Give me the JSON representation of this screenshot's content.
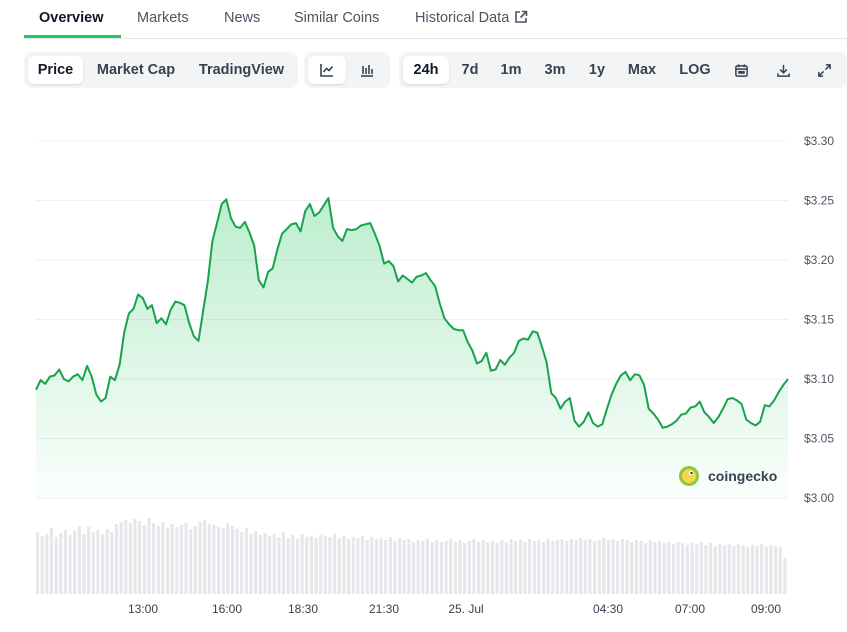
{
  "tabs": [
    {
      "label": "Overview",
      "active": true
    },
    {
      "label": "Markets"
    },
    {
      "label": "News"
    },
    {
      "label": "Similar Coins"
    },
    {
      "label": "Historical Data",
      "external": true
    }
  ],
  "toolbar": {
    "metric_buttons": [
      "Price",
      "Market Cap",
      "TradingView"
    ],
    "active_metric": "Price",
    "chart_type_buttons": [
      "line-chart-icon",
      "candlestick-icon"
    ],
    "active_chart_type": "line-chart-icon",
    "range_buttons": [
      "24h",
      "7d",
      "1m",
      "3m",
      "1y",
      "Max",
      "LOG"
    ],
    "active_range": "24h",
    "action_icons": [
      "calendar-icon",
      "download-icon",
      "expand-icon"
    ]
  },
  "colors": {
    "accent": "#22c55e",
    "line": "#16a34a",
    "volume": "#e5e7eb"
  },
  "watermark": {
    "text": "coingecko"
  },
  "chart_data": {
    "type": "area",
    "xlabel": "",
    "ylabel": "",
    "ylim": [
      3.0,
      3.3
    ],
    "y_ticks": [
      "$3.30",
      "$3.25",
      "$3.20",
      "$3.15",
      "$3.10",
      "$3.05",
      "$3.00"
    ],
    "x_ticks": [
      "13:00",
      "16:00",
      "18:30",
      "21:30",
      "25. Jul",
      "04:30",
      "07:00",
      "09:00"
    ],
    "grid": true,
    "legend": "none",
    "series": [
      {
        "values": [
          3.091,
          3.099,
          3.096,
          3.102,
          3.103,
          3.108,
          3.1,
          3.098,
          3.102,
          3.104,
          3.099,
          3.111,
          3.102,
          3.087,
          3.081,
          3.084,
          3.102,
          3.099,
          3.112,
          3.139,
          3.155,
          3.159,
          3.171,
          3.168,
          3.159,
          3.162,
          3.147,
          3.151,
          3.146,
          3.158,
          3.165,
          3.164,
          3.162,
          3.147,
          3.136,
          3.132,
          3.157,
          3.182,
          3.216,
          3.231,
          3.247,
          3.251,
          3.235,
          3.228,
          3.227,
          3.232,
          3.223,
          3.212,
          3.183,
          3.177,
          3.19,
          3.193,
          3.209,
          3.222,
          3.226,
          3.23,
          3.231,
          3.224,
          3.241,
          3.247,
          3.237,
          3.24,
          3.246,
          3.252,
          3.227,
          3.22,
          3.216,
          3.226,
          3.225,
          3.226,
          3.229,
          3.23,
          3.231,
          3.222,
          3.212,
          3.197,
          3.199,
          3.195,
          3.182,
          3.187,
          3.184,
          3.181,
          3.186,
          3.187,
          3.189,
          3.183,
          3.178,
          3.163,
          3.151,
          3.146,
          3.142,
          3.141,
          3.141,
          3.131,
          3.124,
          3.113,
          3.115,
          3.122,
          3.107,
          3.108,
          3.116,
          3.112,
          3.118,
          3.122,
          3.132,
          3.134,
          3.133,
          3.14,
          3.139,
          3.127,
          3.114,
          3.088,
          3.084,
          3.075,
          3.081,
          3.084,
          3.065,
          3.06,
          3.064,
          3.072,
          3.063,
          3.06,
          3.062,
          3.075,
          3.087,
          3.096,
          3.103,
          3.106,
          3.099,
          3.104,
          3.103,
          3.095,
          3.075,
          3.071,
          3.066,
          3.059,
          3.06,
          3.062,
          3.065,
          3.07,
          3.071,
          3.076,
          3.077,
          3.081,
          3.072,
          3.068,
          3.063,
          3.068,
          3.075,
          3.083,
          3.084,
          3.082,
          3.079,
          3.066,
          3.063,
          3.061,
          3.064,
          3.078,
          3.077,
          3.082,
          3.089,
          3.095,
          3.1
        ]
      }
    ],
    "volume": [
      0.62,
      0.58,
      0.6,
      0.66,
      0.57,
      0.61,
      0.64,
      0.59,
      0.63,
      0.68,
      0.6,
      0.67,
      0.62,
      0.64,
      0.6,
      0.65,
      0.62,
      0.7,
      0.72,
      0.74,
      0.71,
      0.75,
      0.73,
      0.69,
      0.76,
      0.71,
      0.68,
      0.72,
      0.66,
      0.7,
      0.67,
      0.69,
      0.71,
      0.65,
      0.68,
      0.72,
      0.74,
      0.7,
      0.69,
      0.67,
      0.66,
      0.71,
      0.68,
      0.65,
      0.62,
      0.66,
      0.6,
      0.63,
      0.59,
      0.61,
      0.58,
      0.6,
      0.57,
      0.62,
      0.56,
      0.59,
      0.55,
      0.6,
      0.57,
      0.58,
      0.56,
      0.59,
      0.58,
      0.57,
      0.6,
      0.56,
      0.58,
      0.55,
      0.57,
      0.56,
      0.58,
      0.54,
      0.57,
      0.55,
      0.56,
      0.54,
      0.57,
      0.53,
      0.56,
      0.54,
      0.55,
      0.52,
      0.54,
      0.53,
      0.55,
      0.52,
      0.54,
      0.52,
      0.53,
      0.55,
      0.52,
      0.54,
      0.51,
      0.53,
      0.55,
      0.52,
      0.54,
      0.52,
      0.53,
      0.51,
      0.54,
      0.52,
      0.55,
      0.53,
      0.54,
      0.52,
      0.55,
      0.53,
      0.54,
      0.52,
      0.55,
      0.53,
      0.54,
      0.55,
      0.53,
      0.55,
      0.54,
      0.56,
      0.54,
      0.55,
      0.53,
      0.54,
      0.56,
      0.54,
      0.55,
      0.53,
      0.55,
      0.54,
      0.52,
      0.54,
      0.53,
      0.51,
      0.54,
      0.52,
      0.53,
      0.51,
      0.52,
      0.5,
      0.52,
      0.51,
      0.49,
      0.51,
      0.5,
      0.52,
      0.49,
      0.51,
      0.48,
      0.5,
      0.49,
      0.5,
      0.48,
      0.5,
      0.49,
      0.47,
      0.49,
      0.48,
      0.5,
      0.47,
      0.49,
      0.48,
      0.47,
      0.36
    ]
  }
}
